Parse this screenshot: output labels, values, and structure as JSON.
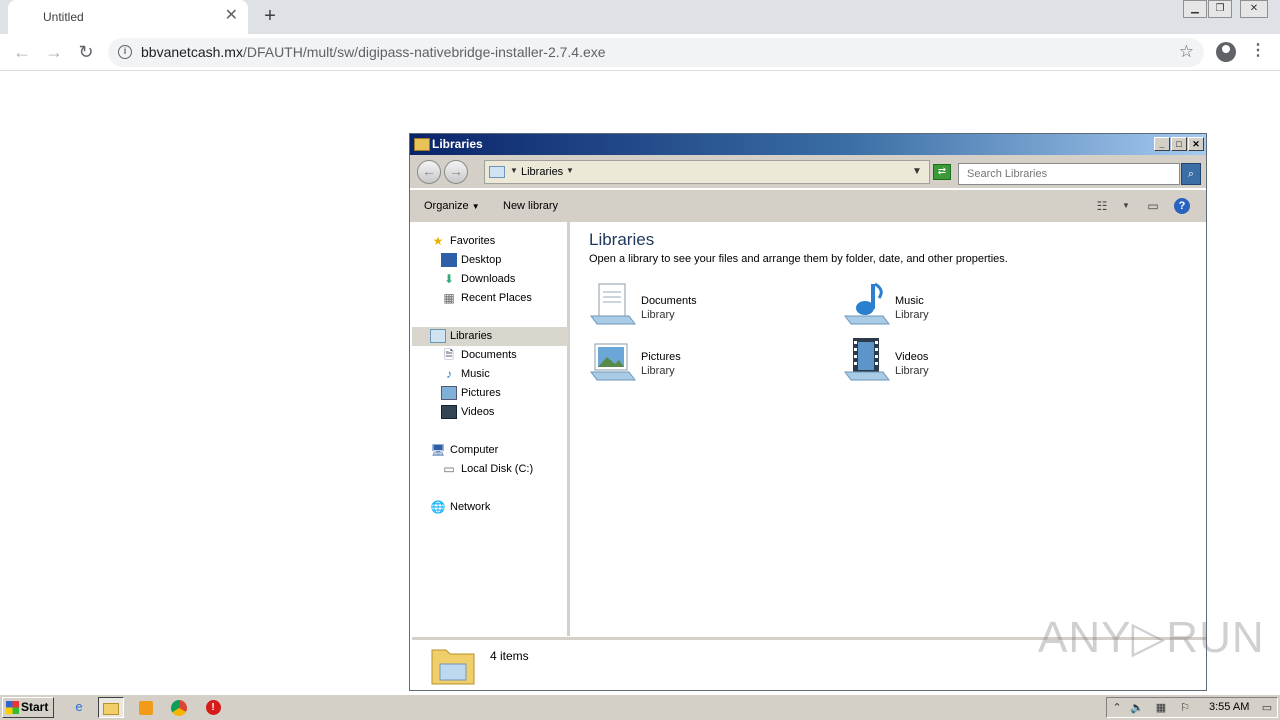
{
  "browser": {
    "tab_title": "Untitled",
    "tab_close": "✕",
    "new_tab": "+",
    "url_host": "bbvanetcash.mx",
    "url_path": "/DFAUTH/mult/sw/digipass-nativebridge-installer-2.7.4.exe",
    "window_controls": [
      "▁",
      "❐",
      "✕"
    ]
  },
  "explorer": {
    "title": "Libraries",
    "address": "Libraries",
    "search_placeholder": "Search Libraries",
    "toolbar": {
      "organize": "Organize",
      "new_library": "New library"
    },
    "nav": {
      "favorites": "Favorites",
      "favorites_items": [
        "Desktop",
        "Downloads",
        "Recent Places"
      ],
      "libraries": "Libraries",
      "libraries_items": [
        "Documents",
        "Music",
        "Pictures",
        "Videos"
      ],
      "computer": "Computer",
      "computer_items": [
        "Local Disk (C:)"
      ],
      "network": "Network"
    },
    "content": {
      "heading": "Libraries",
      "description": "Open a library to see your files and arrange them by folder, date, and other properties.",
      "libraries": [
        {
          "name": "Documents",
          "sub": "Library",
          "icon": "documents-library-icon"
        },
        {
          "name": "Music",
          "sub": "Library",
          "icon": "music-library-icon"
        },
        {
          "name": "Pictures",
          "sub": "Library",
          "icon": "pictures-library-icon"
        },
        {
          "name": "Videos",
          "sub": "Library",
          "icon": "videos-library-icon"
        }
      ]
    },
    "status": "4 items"
  },
  "watermark": "ANY▷RUN",
  "taskbar": {
    "start": "Start",
    "clock": "3:55 AM"
  },
  "colors": {
    "title_gradient_start": "#0a246a",
    "title_gradient_end": "#a6caf0",
    "taskbar": "#d4d0c8"
  }
}
